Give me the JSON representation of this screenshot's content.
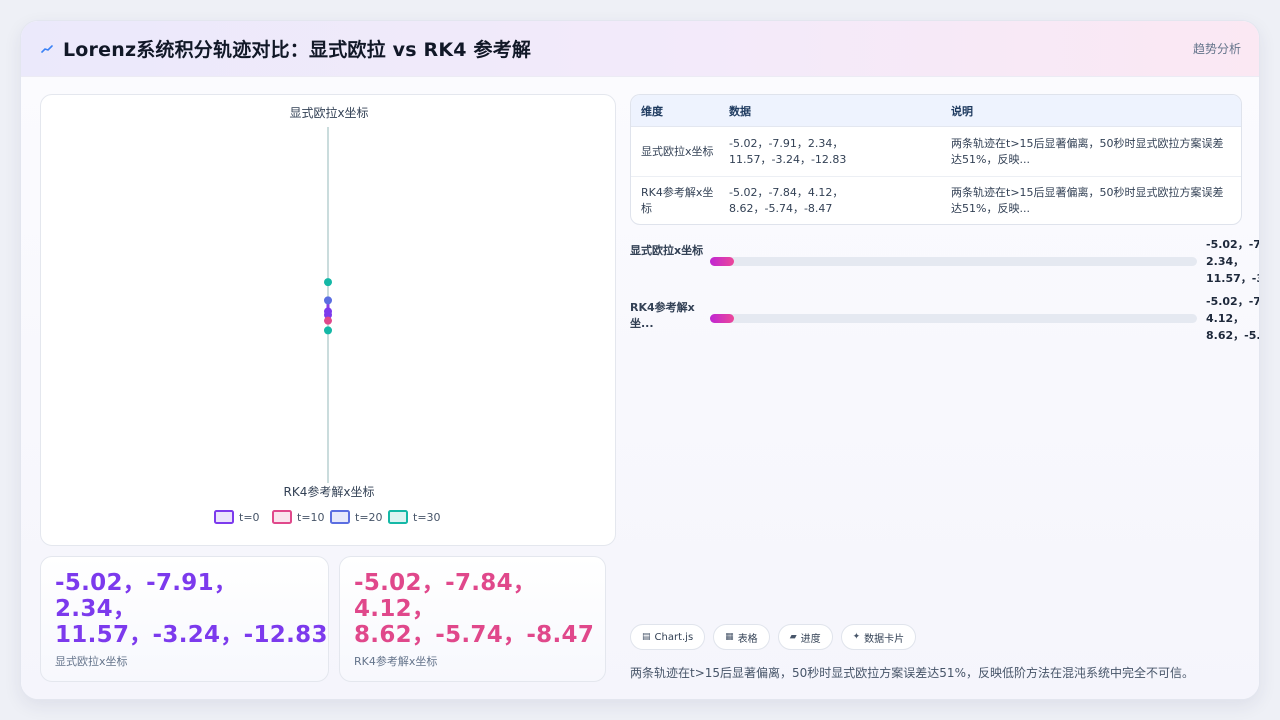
{
  "header": {
    "icon": "trend-line-icon",
    "title": "Lorenz系统积分轨迹对比：显式欧拉 vs RK4 参考解",
    "action_label": "趋势分析"
  },
  "chart_data": {
    "type": "scatter",
    "title": "显式欧拉x坐标",
    "xlabel": "RK4参考解x坐标",
    "ylabel": "",
    "legend_position": "bottom",
    "legend": [
      "t=0",
      "t=10",
      "t=20",
      "t=30"
    ],
    "series_colors": [
      "#7c3aed",
      "#e0488b",
      "#5b6ee1",
      "#14b8a6"
    ],
    "points": [
      {
        "x": -5.02,
        "y": -5.02,
        "series": 0
      },
      {
        "x": -7.84,
        "y": -7.91,
        "series": 1
      },
      {
        "x": 4.12,
        "y": 2.34,
        "series": 2
      },
      {
        "x": 8.62,
        "y": 11.57,
        "series": 3
      },
      {
        "x": -5.74,
        "y": -3.24,
        "series": 0
      },
      {
        "x": -8.47,
        "y": -12.83,
        "series": 3
      }
    ],
    "grid": false
  },
  "stats": [
    {
      "value": "-5.02，-7.91，\n2.34，\n11.57，-3.24，-12.83",
      "label": "显式欧拉x坐标"
    },
    {
      "value": "-5.02，-7.84，\n4.12，\n8.62，-5.74，-8.47",
      "label": "RK4参考解x坐标"
    }
  ],
  "table": {
    "headers": [
      "维度",
      "数据",
      "说明"
    ],
    "rows": [
      [
        "显式欧拉x坐标",
        "-5.02，-7.91，2.34，11.57，-3.24，-12.83",
        "两条轨迹在t>15后显著偏离，50秒时显式欧拉方案误差达51%，反映..."
      ],
      [
        "RK4参考解x坐标",
        "-5.02，-7.84，4.12，8.62，-5.74，-8.47",
        "两条轨迹在t>15后显著偏离，50秒时显式欧拉方案误差达51%，反映..."
      ]
    ]
  },
  "progress": [
    {
      "label": "显式欧拉x坐标",
      "value_text": "-5.02，-7\n2.34，\n11.57，-3",
      "fraction": 0.05
    },
    {
      "label": "RK4参考解x坐...",
      "value_text": "-5.02，-7\n4.12，\n8.62，-5.",
      "fraction": 0.05
    }
  ],
  "chips": [
    {
      "icon": "chart-icon",
      "glyph": "▤",
      "label": "Chart.js"
    },
    {
      "icon": "table-icon",
      "glyph": "▦",
      "label": "表格"
    },
    {
      "icon": "progress-icon",
      "glyph": "▰",
      "label": "进度"
    },
    {
      "icon": "data-card-icon",
      "glyph": "✦",
      "label": "数据卡片"
    }
  ],
  "footer_note": "两条轨迹在t>15后显著偏离，50秒时显式欧拉方案误差达51%，反映低阶方法在混沌系统中完全不可信。"
}
